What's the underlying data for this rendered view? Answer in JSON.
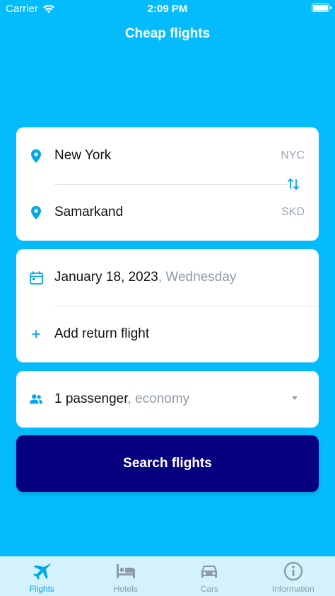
{
  "status_bar": {
    "carrier": "Carrier",
    "time": "2:09 PM"
  },
  "title": "Cheap flights",
  "route": {
    "origin": {
      "city": "New York",
      "code": "NYC"
    },
    "destination": {
      "city": "Samarkand",
      "code": "SKD"
    }
  },
  "dates": {
    "departure": "January 18, 2023",
    "weekday": ", Wednesday",
    "return_label": "Add return flight"
  },
  "passengers": {
    "count": "1 passenger",
    "class": ", economy"
  },
  "search_button": "Search flights",
  "tabs": [
    {
      "label": "Flights",
      "icon": "airplane-icon",
      "active": true
    },
    {
      "label": "Hotels",
      "icon": "bed-icon",
      "active": false
    },
    {
      "label": "Cars",
      "icon": "car-icon",
      "active": false
    },
    {
      "label": "Information",
      "icon": "info-icon",
      "active": false
    }
  ],
  "colors": {
    "background": "#04BCFB",
    "accent": "#04A7E8",
    "button": "#07007F",
    "tab_bar": "#D3F2FD",
    "muted": "#8E9AA8"
  }
}
